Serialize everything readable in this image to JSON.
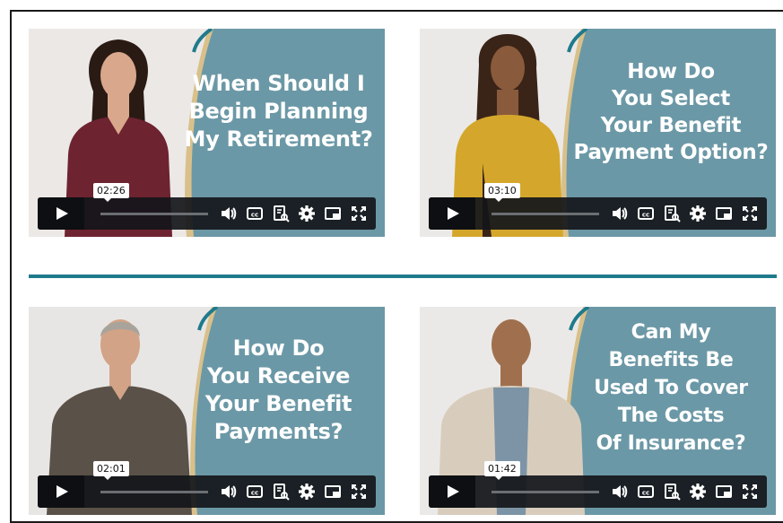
{
  "colors": {
    "teal": "#6b98a6",
    "accent_stripe": "#1f7a8c",
    "gold_stripe": "#d9c08a",
    "controls_bg": "#14161a"
  },
  "videos": [
    {
      "title": "When Should I\nBegin Planning\nMy Retirement?",
      "duration": "02:26",
      "person": {
        "top": "#6e2330",
        "skin": "#d9a88c",
        "hair": "#2a1a14",
        "bg": "#e9e7e5"
      }
    },
    {
      "title": "How Do\nYou Select\nYour Benefit\nPayment Option?",
      "duration": "03:10",
      "person": {
        "top": "#d4a72c",
        "skin": "#8a5a3c",
        "hair": "#3a2418",
        "bg": "#ebe9e7"
      }
    },
    {
      "title": "How Do\nYou Receive\nYour Benefit\nPayments?",
      "duration": "02:01",
      "person": {
        "top": "#5a5148",
        "skin": "#d2a386",
        "hair": "#a8a49c",
        "bg": "#e8e6e4"
      }
    },
    {
      "title": "Can My\nBenefits Be\nUsed To Cover\nThe Costs\nOf Insurance?",
      "duration": "01:42",
      "person": {
        "top": "#d8cdbd",
        "skin": "#a0704e",
        "hair": "#5a3e2c",
        "bg": "#ebe9e7"
      }
    }
  ],
  "control_icons": [
    "play-icon",
    "volume-icon",
    "captions-icon",
    "transcript-icon",
    "settings-icon",
    "picture-in-picture-icon",
    "fullscreen-icon"
  ]
}
